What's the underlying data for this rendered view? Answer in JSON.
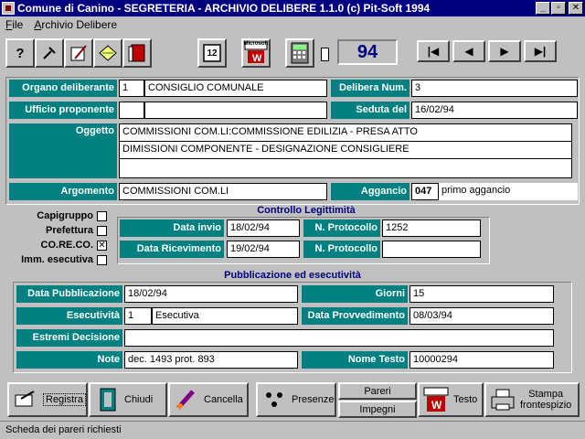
{
  "window": {
    "title": "Comune di Canino - SEGRETERIA - ARCHIVIO DELIBERE 1.1.0 (c) Pit-Soft 1994"
  },
  "menu": [
    {
      "label": "File"
    },
    {
      "label": "Archivio Delibere"
    }
  ],
  "toolbar": {
    "calendar_text": "12",
    "ms_word_text": "Microsoft",
    "counter": "94"
  },
  "nav": {
    "first": "|◀",
    "prev": "◀",
    "next": "▶",
    "last": "▶|"
  },
  "form": {
    "organo_label": "Organo deliberante",
    "organo_code": "1",
    "organo_value": "CONSIGLIO COMUNALE",
    "delibera_label": "Delibera Num.",
    "delibera_value": "3",
    "ufficio_label": "Ufficio proponente",
    "ufficio_code": "",
    "ufficio_value": "",
    "seduta_label": "Seduta del",
    "seduta_value": "16/02/94",
    "oggetto_label": "Oggetto",
    "oggetto_lines": [
      "COMMISSIONI COM.LI:COMMISSIONE EDILIZIA - PRESA ATTO",
      "DIMISSIONI COMPONENTE - DESIGNAZIONE CONSIGLIERE",
      ""
    ],
    "argomento_label": "Argomento",
    "argomento_value": "COMMISSIONI COM.LI",
    "aggancio_label": "Aggancio",
    "aggancio_code": "047",
    "aggancio_value": "primo aggancio"
  },
  "checks": [
    {
      "label": "Capigruppo",
      "checked": ""
    },
    {
      "label": "Prefettura",
      "checked": ""
    },
    {
      "label": "CO.RE.CO.",
      "checked": "✕"
    },
    {
      "label": "Imm. esecutiva",
      "checked": ""
    }
  ],
  "controllo": {
    "title": "Controllo Legittimità",
    "data_invio_label": "Data invio",
    "data_invio_value": "18/02/94",
    "protocollo1_label": "N. Protocollo",
    "protocollo1_value": "1252",
    "data_ricevimento_label": "Data Ricevimento",
    "data_ricevimento_value": "19/02/94",
    "protocollo2_label": "N. Protocollo",
    "protocollo2_value": ""
  },
  "pubblicazione": {
    "title": "Pubblicazione ed esecutività",
    "data_pub_label": "Data Pubblicazione",
    "data_pub_value": "18/02/94",
    "giorni_label": "Giorni",
    "giorni_value": "15",
    "esecutivita_label": "Esecutività",
    "esecutivita_code": "1",
    "esecutivita_value": "Esecutiva",
    "data_prov_label": "Data Provvedimento",
    "data_prov_value": "08/03/94",
    "estremi_label": "Estremi Decisione",
    "estremi_value": "",
    "note_label": "Note",
    "note_value": "dec. 1493 prot. 893",
    "nome_testo_label": "Nome Testo",
    "nome_testo_value": "10000294"
  },
  "buttons": {
    "registra": "Registra",
    "chiudi": "Chiudi",
    "cancella": "Cancella",
    "presenze": "Presenze",
    "pareri": "Pareri",
    "impegni": "Impegni",
    "testo": "Testo",
    "stampa_1": "Stampa",
    "stampa_2": "frontespizio"
  },
  "status": {
    "text": "Scheda dei pareri richiesti"
  },
  "colors": {
    "label_bg": "#008080",
    "title_bg": "#000080",
    "window_bg": "#c0c0c0"
  }
}
